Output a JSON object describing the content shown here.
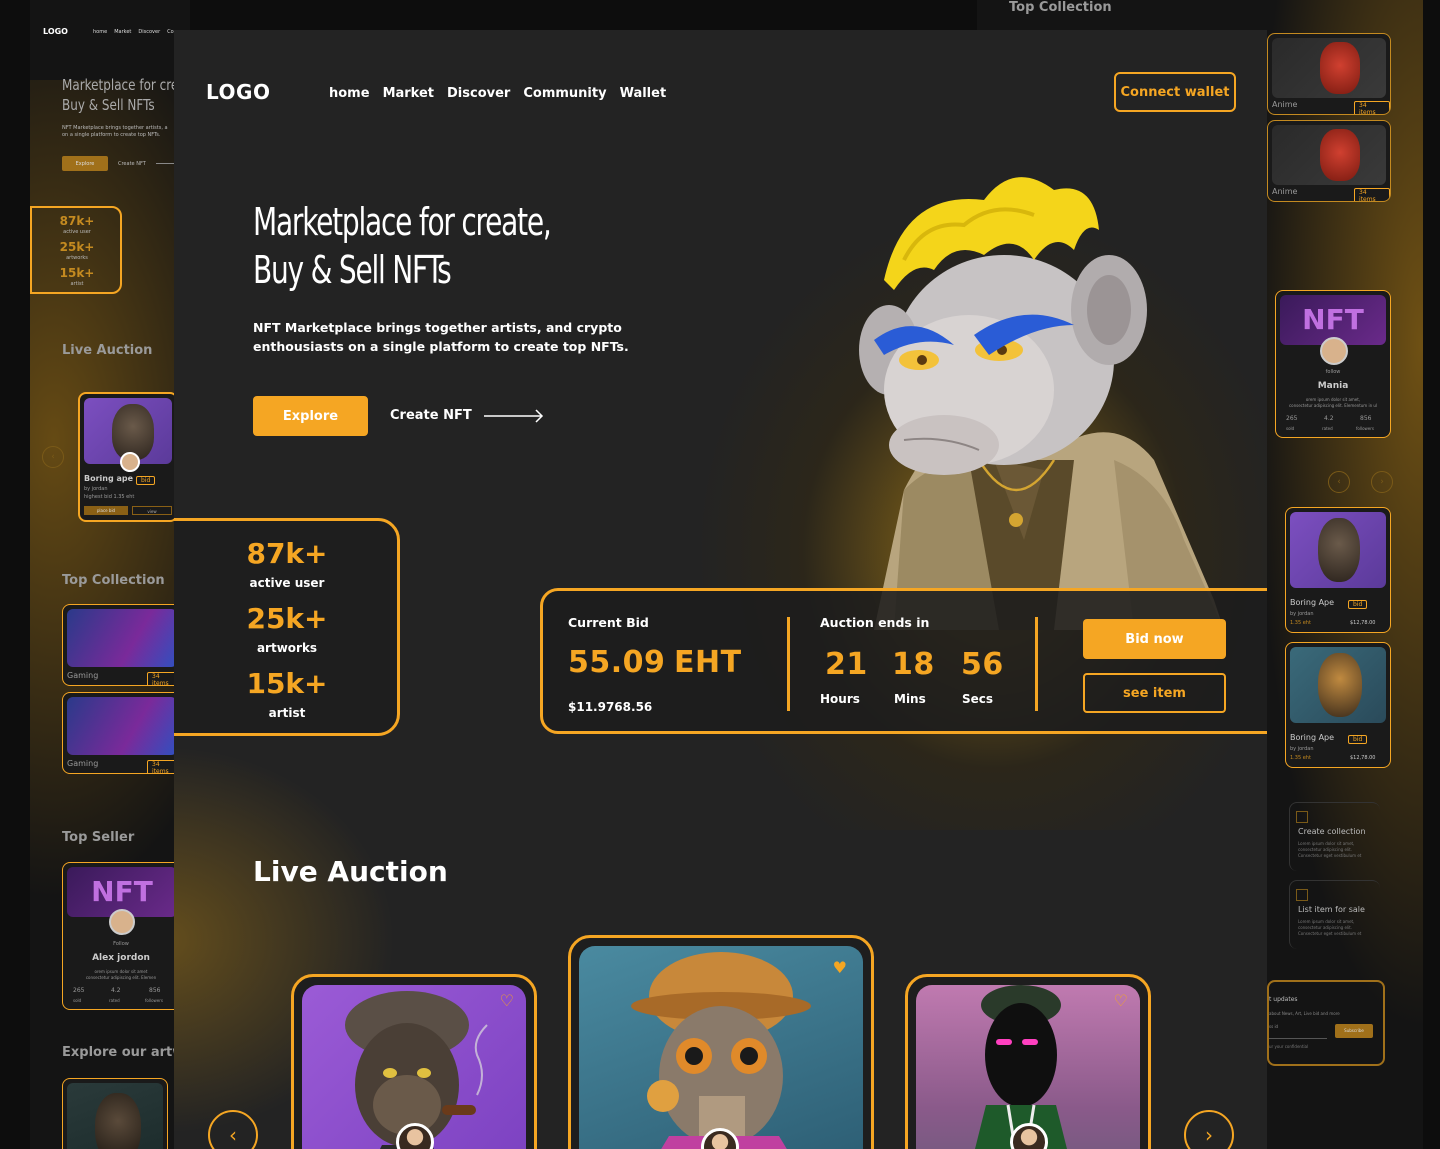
{
  "colors": {
    "accent": "#f5a623",
    "background": "#232323",
    "outer": "#0d0d0d"
  },
  "brand": {
    "logo": "LOGO"
  },
  "nav": {
    "items": [
      "home",
      "Market",
      "Discover",
      "Community",
      "Wallet"
    ],
    "connect_label": "Connect wallet"
  },
  "hero": {
    "title_line1": "Marketplace for create,",
    "title_line2": "Buy & Sell NFTs",
    "subtitle": "NFT Marketplace brings together artists, and crypto enthousiasts on a single platform to create top NFTs.",
    "explore_label": "Explore",
    "create_label": "Create NFT"
  },
  "stats": [
    {
      "value": "87k+",
      "label": "active user"
    },
    {
      "value": "25k+",
      "label": "artworks"
    },
    {
      "value": "15k+",
      "label": "artist"
    }
  ],
  "bid": {
    "current_label": "Current Bid",
    "amount": "55.09",
    "currency": "EHT",
    "usd": "$11.9768.56",
    "ends_label": "Auction ends in",
    "hours": "21",
    "hours_label": "Hours",
    "mins": "18",
    "mins_label": "Mins",
    "secs": "56",
    "secs_label": "Secs",
    "bid_now": "Bid now",
    "see_item": "see item"
  },
  "live_auction": {
    "title": "Live Auction",
    "prev_icon": "chevron-left-icon",
    "next_icon": "chevron-right-icon"
  },
  "background": {
    "left": {
      "logo": "LOGO",
      "nav": [
        "home",
        "Market",
        "Discover",
        "Co"
      ],
      "title1": "Marketplace for cre",
      "title2": "Buy & Sell NFTs",
      "sub1": "NFT Marketplace brings together artists, a",
      "sub2": "on a single platform to create top NFTs.",
      "explore": "Explore",
      "create": "Create NFT",
      "stats": [
        {
          "v": "87k+",
          "l": "active user"
        },
        {
          "v": "25k+",
          "l": "artworks"
        },
        {
          "v": "15k+",
          "l": "artist"
        }
      ],
      "live_auction": "Live Auction",
      "card_name": "Boring ape",
      "card_by": "by jordan",
      "card_bid": "highest bid 1.35 eht",
      "card_tag": "bid",
      "card_btn1": "place bid",
      "card_btn2": "view",
      "top_collection": "Top Collection",
      "collections": [
        {
          "name": "Gaming",
          "items": "34 items"
        },
        {
          "name": "Gaming",
          "items": "34 items"
        }
      ],
      "top_seller": "Top Seller",
      "seller_follow": "Follow",
      "seller_name": "Alex jordon",
      "seller_desc1": "orem ipsum dolor sit amet",
      "seller_desc2": "consectetur adipiscing elit. Elemen",
      "seller_stats": [
        {
          "v": "265",
          "l": "sold"
        },
        {
          "v": "4.2",
          "l": "rated"
        },
        {
          "v": "856",
          "l": "followers"
        }
      ],
      "explore_art": "Explore our artwo"
    },
    "right": {
      "top_collection": "Top Collection",
      "collections": [
        {
          "name": "Anime",
          "items": "34 items"
        },
        {
          "name": "Anime",
          "items": "34 items"
        }
      ],
      "seller_follow": "follow",
      "seller_name": "Mania",
      "seller_desc1": "orem ipsum dolor sit amet,",
      "seller_desc2": "consectetur adipiscing elit. Elementum in ul",
      "seller_stats": [
        {
          "v": "265",
          "l": "sold"
        },
        {
          "v": "4.2",
          "l": "rated"
        },
        {
          "v": "856",
          "l": "followers"
        }
      ],
      "cards": [
        {
          "name": "Boring Ape",
          "by": "by jordan",
          "tag": "bid",
          "eht": "1.35 eht",
          "price": "$12,78.00"
        },
        {
          "name": "Boring Ape",
          "by": "by jordan",
          "tag": "bid",
          "eht": "1.35 eht",
          "price": "$12,78.00"
        }
      ],
      "feature1": "Create collection",
      "feature2": "List item for sale",
      "feature_desc1": "Lorem ipsum dolor sit amet,",
      "feature_desc2": "consectetur adipiscing elit.",
      "feature_desc3": "Consectetur eget vestibulum et",
      "updates_title": "t updates",
      "updates_desc": "about News, Art, Live bid and more",
      "updates_input": "ss id",
      "subscribe": "Subscribe",
      "updates_note": "ur your confidential"
    }
  }
}
